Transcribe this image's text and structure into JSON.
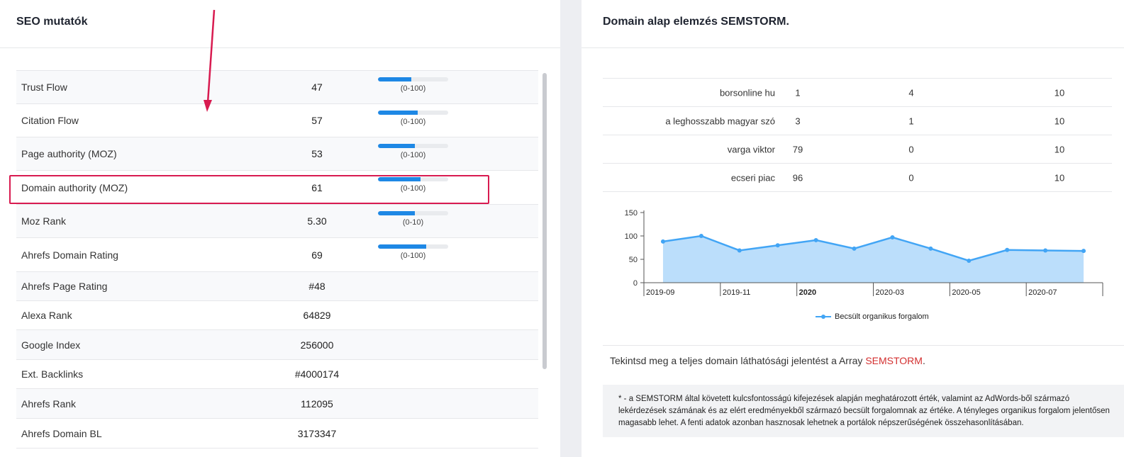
{
  "seo": {
    "title": "SEO mutatók",
    "rows": [
      {
        "label": "Trust Flow",
        "value": "47",
        "bar": 0.47,
        "range": "(0-100)"
      },
      {
        "label": "Citation Flow",
        "value": "57",
        "bar": 0.57,
        "range": "(0-100)"
      },
      {
        "label": "Page authority (MOZ)",
        "value": "53",
        "bar": 0.53,
        "range": "(0-100)"
      },
      {
        "label": "Domain authority (MOZ)",
        "value": "61",
        "bar": 0.61,
        "range": "(0-100)"
      },
      {
        "label": "Moz Rank",
        "value": "5.30",
        "bar": 0.53,
        "range": "(0-10)"
      },
      {
        "label": "Ahrefs Domain Rating",
        "value": "69",
        "bar": 0.69,
        "range": "(0-100)"
      },
      {
        "label": "Ahrefs Page Rating",
        "value": "#48"
      },
      {
        "label": "Alexa Rank",
        "value": "64829"
      },
      {
        "label": "Google Index",
        "value": "256000"
      },
      {
        "label": "Ext. Backlinks",
        "value": "#4000174"
      },
      {
        "label": "Ahrefs Rank",
        "value": "112095"
      },
      {
        "label": "Ahrefs Domain BL",
        "value": "3173347"
      }
    ]
  },
  "domain": {
    "title": "Domain alap elemzés SEMSTORM.",
    "keywords": [
      {
        "keyword": "borsonline hu",
        "c1": "1",
        "c2": "4",
        "c3": "10"
      },
      {
        "keyword": "a leghosszabb magyar szó",
        "c1": "3",
        "c2": "1",
        "c3": "10"
      },
      {
        "keyword": "varga viktor",
        "c1": "79",
        "c2": "0",
        "c3": "10"
      },
      {
        "keyword": "ecseri piac",
        "c1": "96",
        "c2": "0",
        "c3": "10"
      }
    ],
    "report_text": "Tekintsd meg a teljes domain láthatósági jelentést a Array ",
    "report_link": "SEMSTORM",
    "report_end": ".",
    "note": "* - a SEMSTORM által követett kulcsfontosságú kifejezések alapján meghatározott érték, valamint az AdWords-ből származó lekérdezések számának és az elért eredményekből származó becsült forgalomnak az értéke. A tényleges organikus forgalom jelentősen magasabb lehet. A fenti adatok azonban hasznosak lehetnek a portálok népszerűségének összehasonlításában."
  },
  "chart_data": {
    "type": "area",
    "x": [
      "2019-09",
      "2019-10",
      "2019-11",
      "2019-12",
      "2020-01",
      "2020-02",
      "2020-03",
      "2020-04",
      "2020-05",
      "2020-06",
      "2020-07",
      "2020-08"
    ],
    "tick_labels": [
      "2019-09",
      "2019-11",
      "2020",
      "2020-03",
      "2020-05",
      "2020-07"
    ],
    "series": [
      {
        "name": "Becsült organikus forgalom",
        "values": [
          88,
          100,
          69,
          80,
          91,
          73,
          97,
          73,
          47,
          70,
          69,
          68
        ]
      }
    ],
    "yticks": [
      "0",
      "50",
      "100",
      "150"
    ],
    "ylim": [
      0,
      150
    ],
    "legend": "bottom",
    "colors": {
      "line": "#42a5f5",
      "fill": "#bbdefb"
    }
  }
}
